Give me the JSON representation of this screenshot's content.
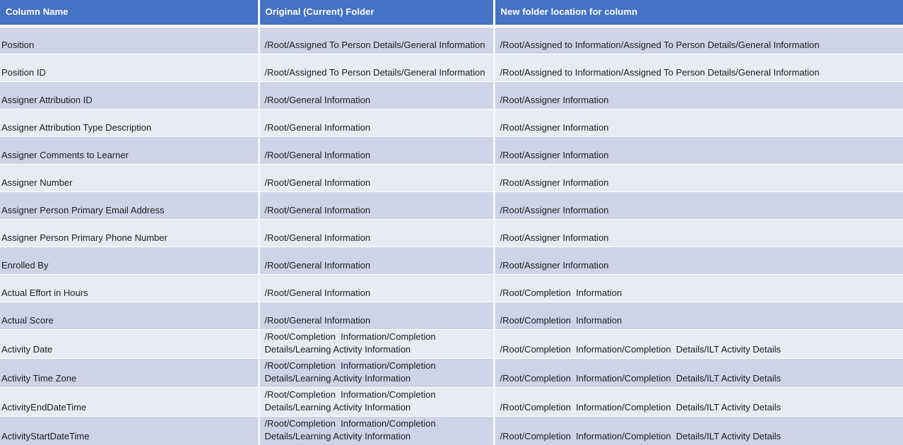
{
  "colors": {
    "header_bg": "#4472C4",
    "header_text": "#FFFFFF",
    "row_dark": "#CFD3E7",
    "row_light": "#E9EBF4",
    "body_text": "#1B1B20"
  },
  "table": {
    "headers": [
      "Column Name",
      "Original (Current) Folder",
      "New folder location for column"
    ],
    "rows": [
      {
        "column_name": "Position",
        "original_folder": "/Root/Assigned To Person Details/General Information",
        "new_folder": "/Root/Assigned to Information/Assigned To Person Details/General Information"
      },
      {
        "column_name": "Position ID",
        "original_folder": "/Root/Assigned To Person Details/General Information",
        "new_folder": "/Root/Assigned to Information/Assigned To Person Details/General Information"
      },
      {
        "column_name": "Assigner Attribution ID",
        "original_folder": "/Root/General Information",
        "new_folder": "/Root/Assigner Information"
      },
      {
        "column_name": "Assigner Attribution Type Description",
        "original_folder": "/Root/General Information",
        "new_folder": "/Root/Assigner Information"
      },
      {
        "column_name": "Assigner Comments to Learner",
        "original_folder": "/Root/General Information",
        "new_folder": "/Root/Assigner Information"
      },
      {
        "column_name": "Assigner Number",
        "original_folder": "/Root/General Information",
        "new_folder": "/Root/Assigner Information"
      },
      {
        "column_name": "Assigner Person Primary Email Address",
        "original_folder": "/Root/General Information",
        "new_folder": "/Root/Assigner Information"
      },
      {
        "column_name": "Assigner Person Primary Phone Number",
        "original_folder": "/Root/General Information",
        "new_folder": "/Root/Assigner Information"
      },
      {
        "column_name": "Enrolled By",
        "original_folder": "/Root/General Information",
        "new_folder": "/Root/Assigner Information"
      },
      {
        "column_name": "Actual Effort in Hours",
        "original_folder": "/Root/General Information",
        "new_folder": "/Root/Completion  Information"
      },
      {
        "column_name": "Actual Score",
        "original_folder": "/Root/General Information",
        "new_folder": "/Root/Completion  Information"
      },
      {
        "column_name": "Activity Date",
        "original_folder": "/Root/Completion  Information/Completion  Details/Learning Activity Information",
        "new_folder": "/Root/Completion  Information/Completion  Details/ILT Activity Details"
      },
      {
        "column_name": "Activity Time Zone",
        "original_folder": "/Root/Completion  Information/Completion  Details/Learning Activity Information",
        "new_folder": "/Root/Completion  Information/Completion  Details/ILT Activity Details"
      },
      {
        "column_name": "ActivityEndDateTime",
        "original_folder": "/Root/Completion  Information/Completion  Details/Learning Activity Information",
        "new_folder": "/Root/Completion  Information/Completion  Details/ILT Activity Details"
      },
      {
        "column_name": "ActivityStartDateTime",
        "original_folder": "/Root/Completion  Information/Completion  Details/Learning Activity Information",
        "new_folder": "/Root/Completion  Information/Completion  Details/ILT Activity Details"
      }
    ]
  }
}
